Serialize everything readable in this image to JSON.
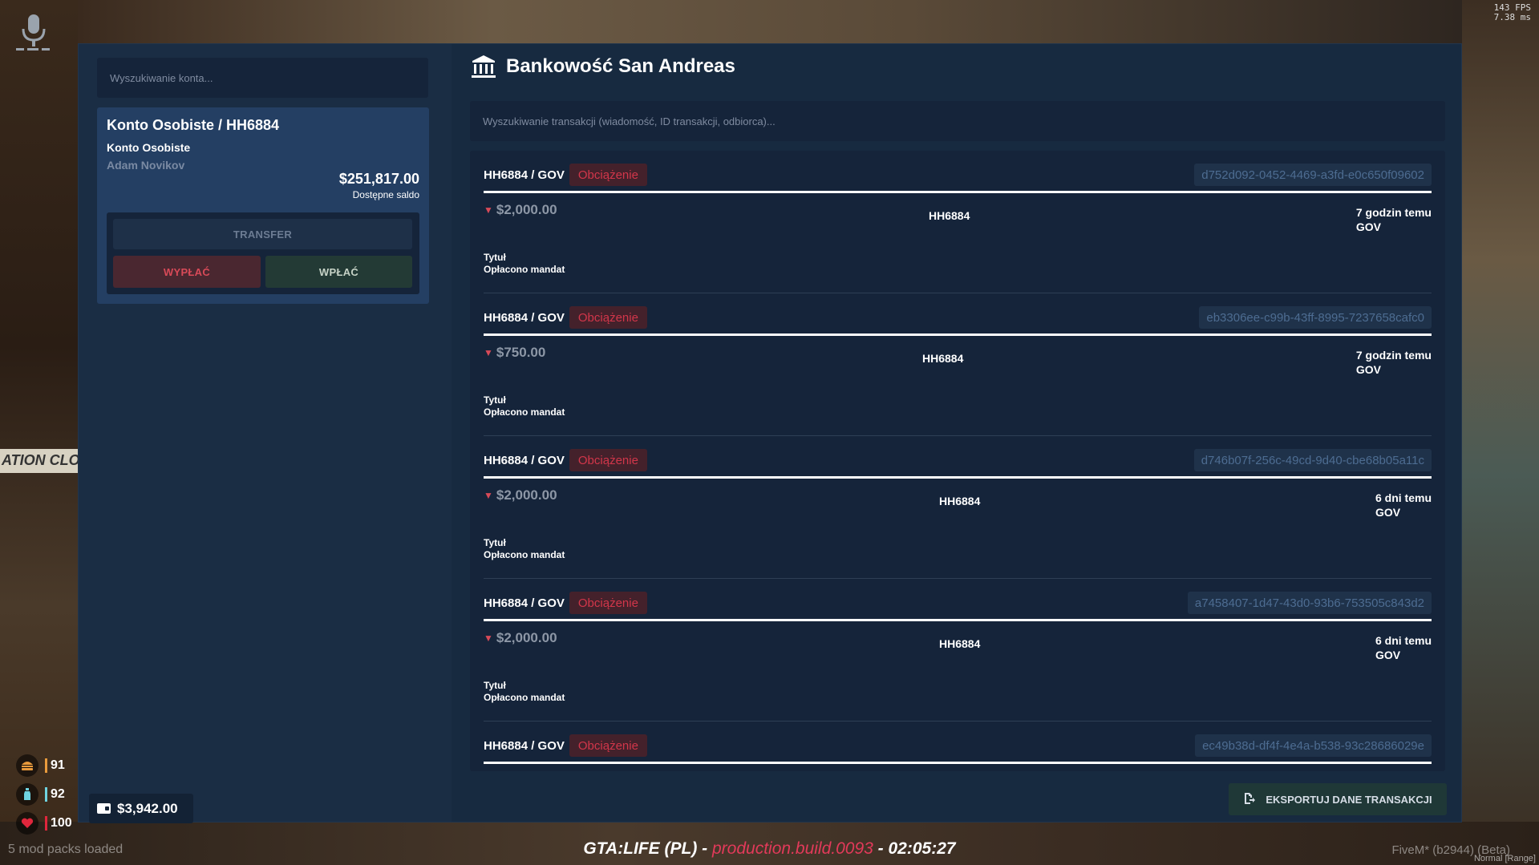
{
  "hud": {
    "fps": "143 FPS",
    "frame_time": "7.38 ms",
    "hunger": "91",
    "thirst": "92",
    "health": "100",
    "mod_packs": "5 mod packs loaded",
    "server_prefix": "GTA:LIFE (PL) - ",
    "server_build": "production.build.0093",
    "server_time": " - 02:05:27",
    "fivem": "FiveM* (b2944) (Beta)",
    "voice_range": "Normal [Range]",
    "wallet_cash": "$3,942.00",
    "bg_sign": "ATION CLOS"
  },
  "sidebar": {
    "search_placeholder": "Wyszukiwanie konta...",
    "account": {
      "title": "Konto Osobiste / HH6884",
      "type": "Konto Osobiste",
      "owner": "Adam Novikov",
      "balance": "$251,817.00",
      "balance_label": "Dostępne saldo"
    },
    "buttons": {
      "transfer": "TRANSFER",
      "withdraw": "WYPŁAĆ",
      "deposit": "WPŁAĆ"
    }
  },
  "main": {
    "title": "Bankowość San Andreas",
    "search_placeholder": "Wyszukiwanie transakcji (wiadomość, ID transakcji, odbiorca)...",
    "export_label": "EKSPORTUJ DANE TRANSAKCJI",
    "transactions": [
      {
        "route": "HH6884 / GOV",
        "type": "Obciążenie",
        "id": "d752d092-0452-4469-a3fd-e0c650f09602",
        "amount": "$2,000.00",
        "party": "HH6884",
        "time": "7 godzin temu",
        "to": "GOV",
        "title_label": "Tytuł",
        "title": "Opłacono mandat"
      },
      {
        "route": "HH6884 / GOV",
        "type": "Obciążenie",
        "id": "eb3306ee-c99b-43ff-8995-7237658cafc0",
        "amount": "$750.00",
        "party": "HH6884",
        "time": "7 godzin temu",
        "to": "GOV",
        "title_label": "Tytuł",
        "title": "Opłacono mandat"
      },
      {
        "route": "HH6884 / GOV",
        "type": "Obciążenie",
        "id": "d746b07f-256c-49cd-9d40-cbe68b05a11c",
        "amount": "$2,000.00",
        "party": "HH6884",
        "time": "6 dni temu",
        "to": "GOV",
        "title_label": "Tytuł",
        "title": "Opłacono mandat"
      },
      {
        "route": "HH6884 / GOV",
        "type": "Obciążenie",
        "id": "a7458407-1d47-43d0-93b6-753505c843d2",
        "amount": "$2,000.00",
        "party": "HH6884",
        "time": "6 dni temu",
        "to": "GOV",
        "title_label": "Tytuł",
        "title": "Opłacono mandat"
      },
      {
        "route": "HH6884 / GOV",
        "type": "Obciążenie",
        "id": "ec49b38d-df4f-4e4a-b538-93c28686029e",
        "amount": "",
        "party": "",
        "time": "",
        "to": "",
        "title_label": "",
        "title": ""
      }
    ]
  },
  "colors": {
    "panel": "#172a40",
    "card": "#243f63",
    "debit": "#d2364a",
    "deposit_btn": "#233a35"
  }
}
